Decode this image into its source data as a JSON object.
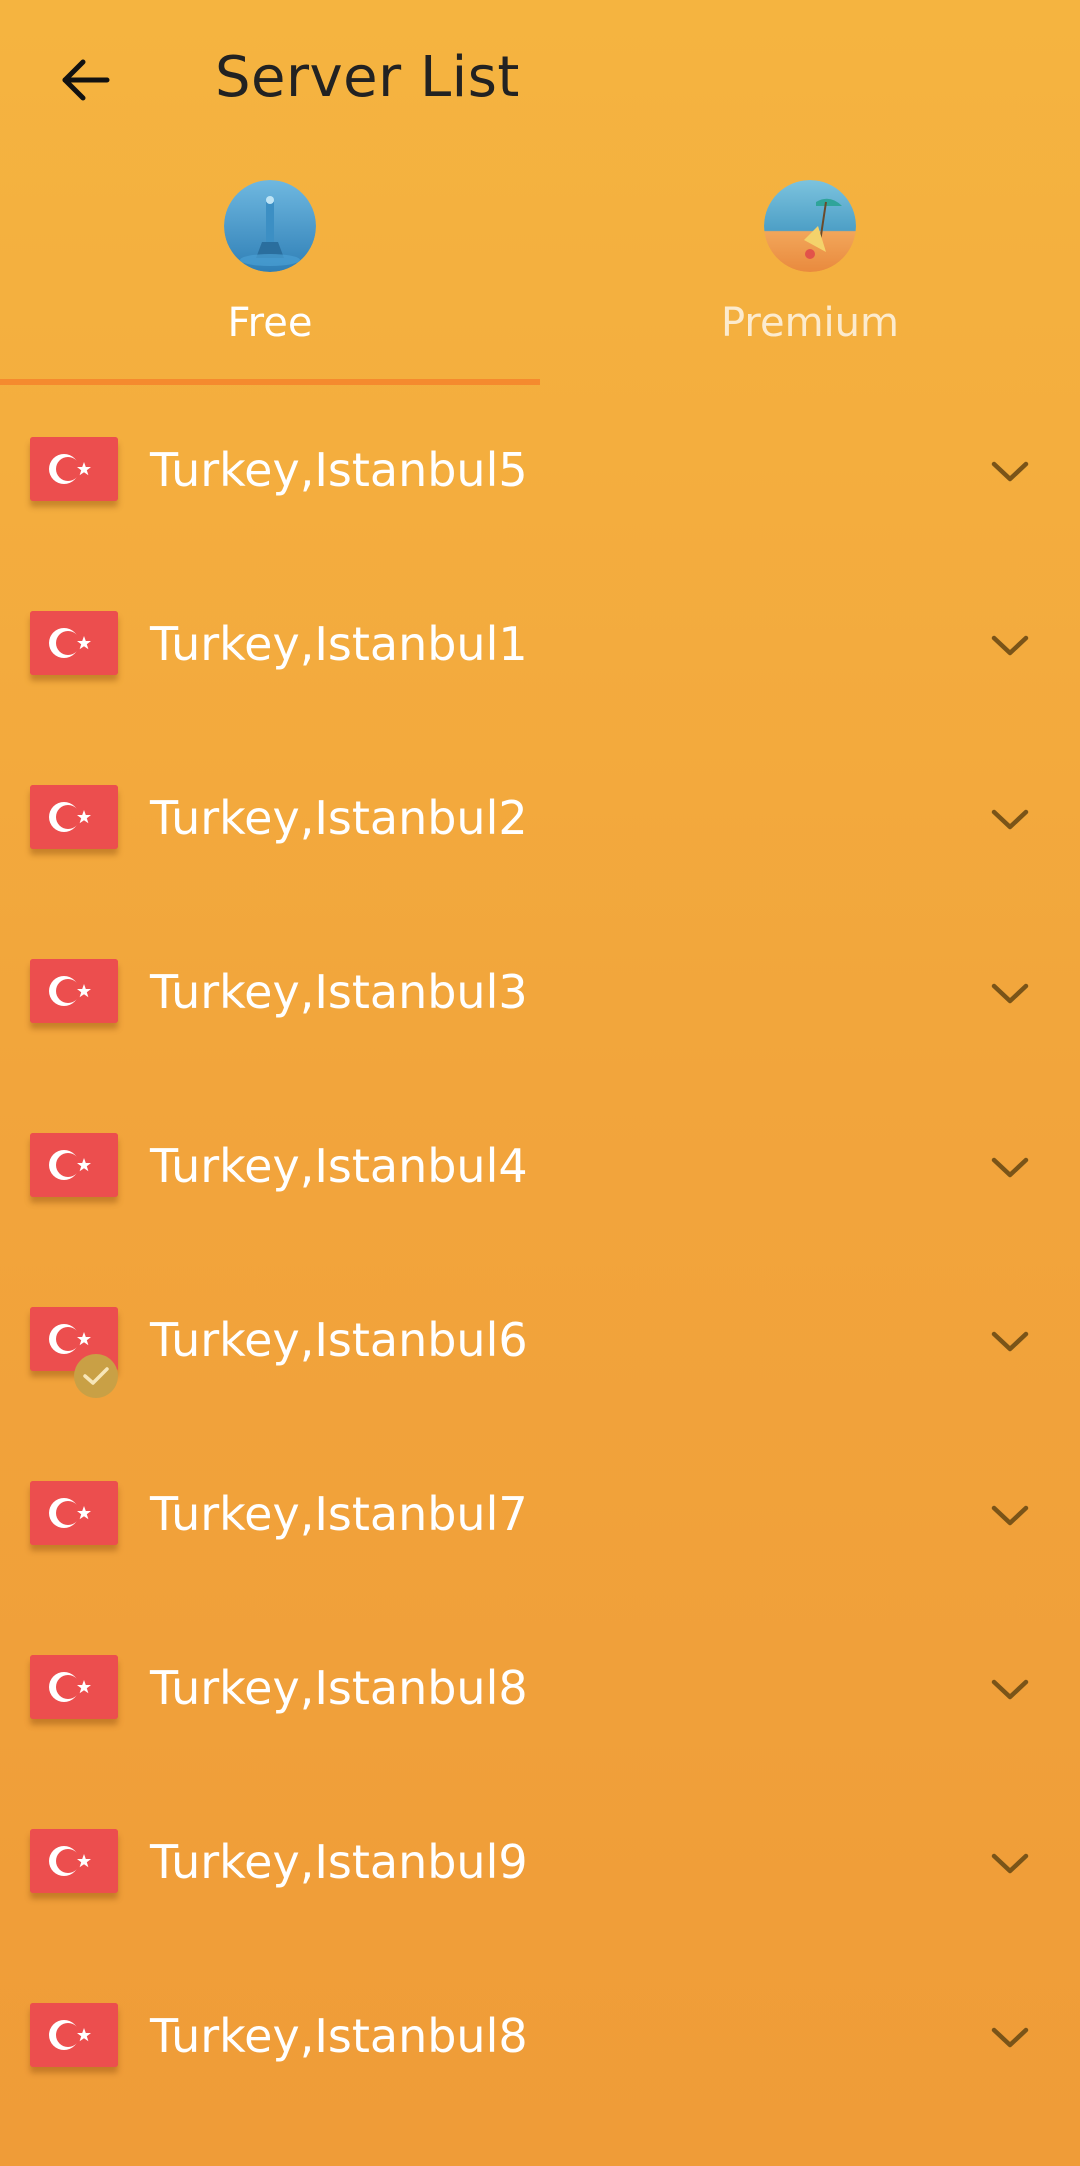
{
  "header": {
    "title": "Server List",
    "back_icon": "arrow-left-icon"
  },
  "tabs": [
    {
      "label": "Free",
      "icon": "lighthouse-globe-icon",
      "active": true
    },
    {
      "label": "Premium",
      "icon": "beach-globe-icon",
      "active": false
    }
  ],
  "servers": [
    {
      "name": "Turkey,Istanbul5",
      "flag": "turkey-flag-icon",
      "selected": false
    },
    {
      "name": "Turkey,Istanbul1",
      "flag": "turkey-flag-icon",
      "selected": false
    },
    {
      "name": "Turkey,Istanbul2",
      "flag": "turkey-flag-icon",
      "selected": false
    },
    {
      "name": "Turkey,Istanbul3",
      "flag": "turkey-flag-icon",
      "selected": false
    },
    {
      "name": "Turkey,Istanbul4",
      "flag": "turkey-flag-icon",
      "selected": false
    },
    {
      "name": "Turkey,Istanbul6",
      "flag": "turkey-flag-icon",
      "selected": true
    },
    {
      "name": "Turkey,Istanbul7",
      "flag": "turkey-flag-icon",
      "selected": false
    },
    {
      "name": "Turkey,Istanbul8",
      "flag": "turkey-flag-icon",
      "selected": false
    },
    {
      "name": "Turkey,Istanbul9",
      "flag": "turkey-flag-icon",
      "selected": false
    },
    {
      "name": "Turkey,Istanbul8",
      "flag": "turkey-flag-icon",
      "selected": false
    }
  ],
  "colors": {
    "background_top": "#F5B440",
    "background_bottom": "#EF9C38",
    "tab_indicator": "#F58A2E",
    "flag_red": "#EC4E4E",
    "chevron": "#7A5418",
    "check_badge": "#C9A045"
  }
}
